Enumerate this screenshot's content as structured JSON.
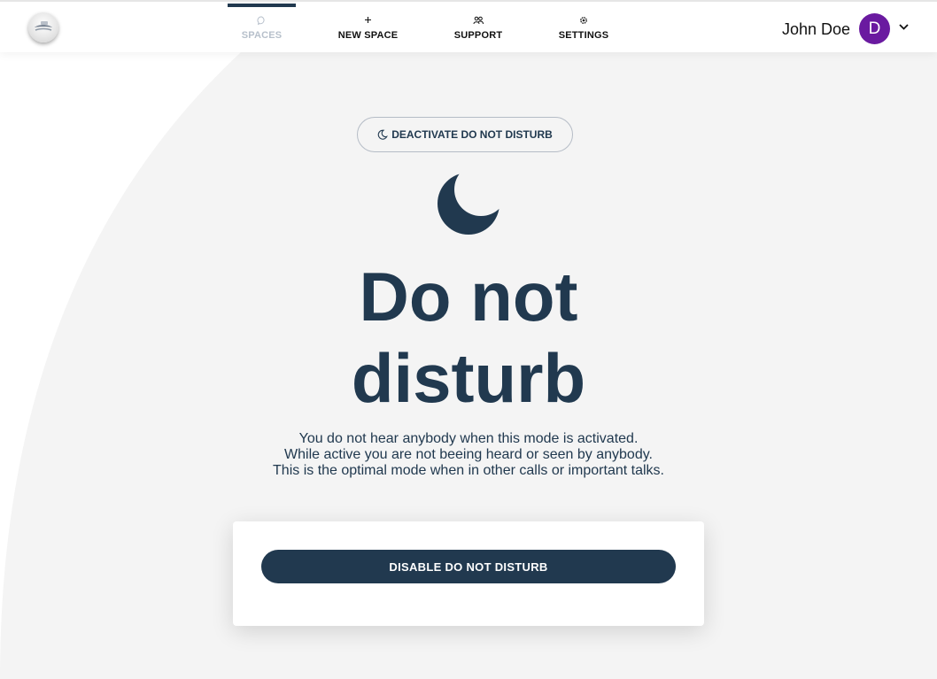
{
  "header": {
    "nav": [
      {
        "label": "SPACES",
        "icon": "chat-bubble-icon",
        "active": true
      },
      {
        "label": "NEW SPACE",
        "icon": "plus-icon",
        "active": false
      },
      {
        "label": "SUPPORT",
        "icon": "people-icon",
        "active": false
      },
      {
        "label": "SETTINGS",
        "icon": "gear-icon",
        "active": false
      }
    ],
    "user": {
      "name": "John Doe",
      "avatar_initial": "D",
      "avatar_color": "#6a1aa0"
    }
  },
  "main": {
    "pill_button_label": "DEACTIVATE DO NOT DISTURB",
    "title_line1": "Do not",
    "title_line2": "disturb",
    "description": [
      "You do not hear anybody when this mode is activated.",
      "While active you are not beeing heard or seen by anybody.",
      "This is the optimal mode when in other calls or important talks."
    ],
    "card": {
      "button_label": "DISABLE DO NOT DISTURB"
    }
  },
  "colors": {
    "primary": "#21394f",
    "background_arc": "#f4f4f4",
    "nav_inactive": "#b7c0cb"
  }
}
